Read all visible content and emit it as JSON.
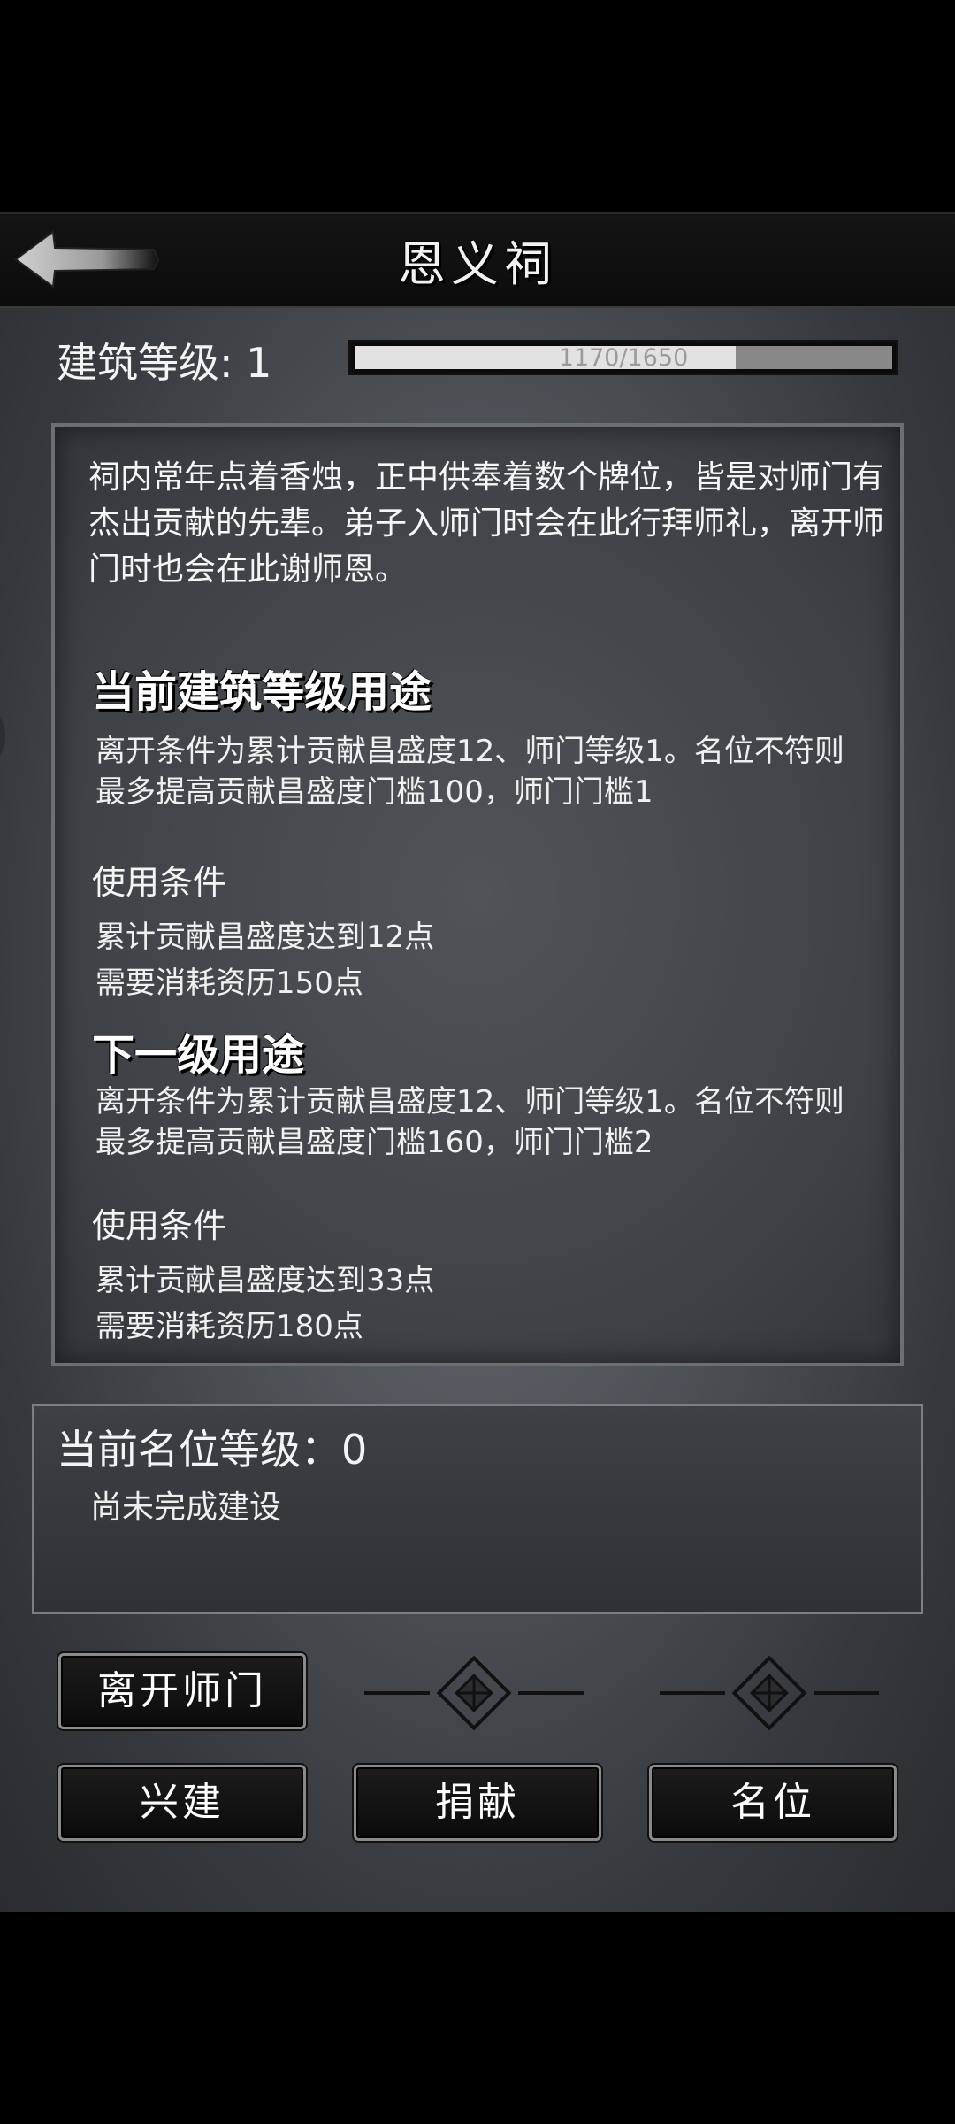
{
  "header": {
    "title": "恩义祠",
    "back_icon": "back-arrow-icon"
  },
  "building": {
    "level_label": "建筑等级: 1",
    "progress_text": "1170/1650",
    "progress_current": 1170,
    "progress_max": 1650
  },
  "info": {
    "description": "祠内常年点着香烛，正中供奉着数个牌位，皆是对师门有杰出贡献的先辈。弟子入师门时会在此行拜师礼，离开师门时也会在此谢师恩。",
    "current": {
      "heading": "当前建筑等级用途",
      "body": "离开条件为累计贡献昌盛度12、师门等级1。名位不符则最多提高贡献昌盛度门槛100，师门门槛1",
      "cond_heading": "使用条件",
      "cond_1": "累计贡献昌盛度达到12点",
      "cond_2": "需要消耗资历150点"
    },
    "next": {
      "heading": "下一级用途",
      "body": "离开条件为累计贡献昌盛度12、师门等级1。名位不符则最多提高贡献昌盛度门槛160，师门门槛2",
      "cond_heading": "使用条件",
      "cond_1": "累计贡献昌盛度达到33点",
      "cond_2": "需要消耗资历180点"
    }
  },
  "rank": {
    "title": "当前名位等级：0",
    "status": "尚未完成建设"
  },
  "buttons": {
    "leave": "离开师门",
    "build": "兴建",
    "donate": "捐献",
    "rank": "名位"
  },
  "colors": {
    "background_dark": "#000000",
    "panel_gray": "#4e5358",
    "progress_fill": "#e2e2e2",
    "progress_track": "#888888",
    "dial_accent": "#2ad0e0",
    "dial_dot": "#ff3b3b"
  }
}
